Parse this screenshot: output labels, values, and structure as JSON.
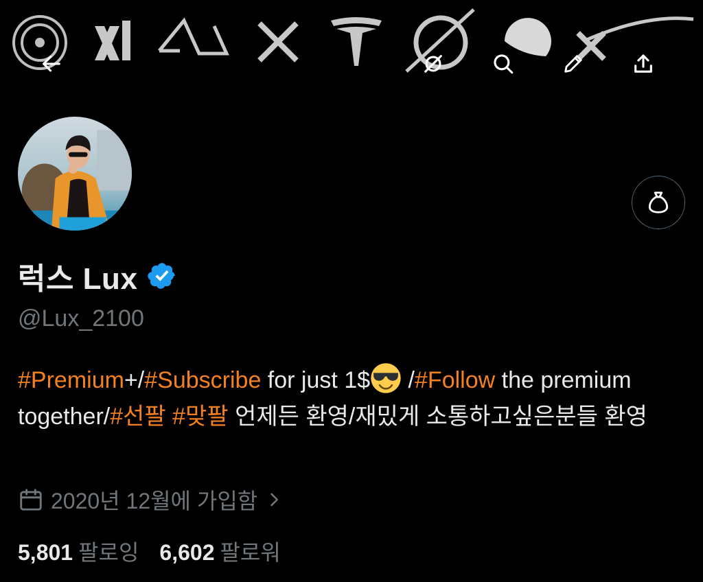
{
  "profile": {
    "display_name": "럭스 Lux",
    "handle": "@Lux_2100",
    "bio": {
      "p1": "#Premium",
      "p2": "+/",
      "p3": "#Subscribe",
      "p4": " for just 1$",
      "p5": " /",
      "p6": "#Follow",
      "p7": " the premium together/",
      "p8": "#선팔",
      "p9": " ",
      "p10": "#맞팔",
      "p11": " 언제든 환영/재밌게 소통하고싶은분들 환영"
    },
    "joined": "2020년 12월에 가입함",
    "following_count": "5,801",
    "following_label": "팔로잉",
    "followers_count": "6,602",
    "followers_label": "팔로워"
  },
  "colors": {
    "hashtag": "#f4811f",
    "verified": "#1d9bf0",
    "secondary_text": "#71767b"
  },
  "icons": {
    "back": "arrow-left-icon",
    "grok": "grok-icon",
    "search": "search-icon",
    "edit": "pencil-icon",
    "share": "share-icon",
    "gift": "money-bag-icon",
    "verified": "verified-badge-icon",
    "calendar": "calendar-icon",
    "chevron": "chevron-right-icon",
    "emoji": "sunglasses-emoji"
  }
}
